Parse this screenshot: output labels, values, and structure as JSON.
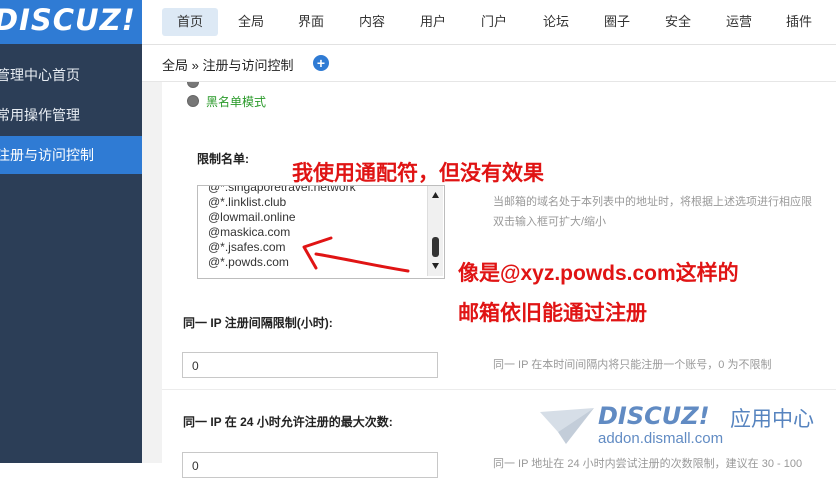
{
  "app": {
    "logo_text": "DISCUZ!"
  },
  "sidebar": {
    "items": [
      {
        "label": "管理中心首页"
      },
      {
        "label": "常用操作管理"
      },
      {
        "label": "注册与访问控制",
        "active": true
      }
    ]
  },
  "topnav": {
    "items": [
      "首页",
      "全局",
      "界面",
      "内容",
      "用户",
      "门户",
      "论坛",
      "圈子",
      "安全",
      "运营",
      "插件"
    ],
    "active": "首页"
  },
  "breadcrumb": {
    "text": "全局 » 注册与访问控制",
    "add": "+"
  },
  "form": {
    "mode_option": "黑名单模式",
    "restrict_label": "限制名单:",
    "restrict_lines": [
      "@*.singaporetravel.network",
      "@*.linklist.club",
      "@lowmail.online",
      "@maskica.com",
      "@*.jsafes.com",
      "@*.powds.com"
    ],
    "restrict_hint_1": "当邮箱的域名处于本列表中的地址时，将根据上述选项进行相应限",
    "restrict_hint_2": "双击输入框可扩大/缩小",
    "ip_interval_label": "同一 IP 注册间隔限制(小时):",
    "ip_interval_value": "0",
    "ip_interval_hint": "同一 IP 在本时间间隔内将只能注册一个账号，0 为不限制",
    "ip_24h_label": "同一 IP 在 24 小时允许注册的最大次数:",
    "ip_24h_value": "0",
    "ip_24h_hint": "同一 IP 地址在 24 小时内尝试注册的次数限制，建议在 30 - 100"
  },
  "annotation": {
    "line1": "我使用通配符，但没有效果",
    "line2": "像是@xyz.powds.com这样的",
    "line3": "邮箱依旧能通过注册"
  },
  "watermark": {
    "brand": "DISCUZ!",
    "cn": "应用中心",
    "url": "addon.dismall.com"
  },
  "colors": {
    "accent": "#2f7bd4",
    "sidebar": "#2c3e57",
    "annotation": "#e01414",
    "option_green": "#2a9a2a"
  }
}
